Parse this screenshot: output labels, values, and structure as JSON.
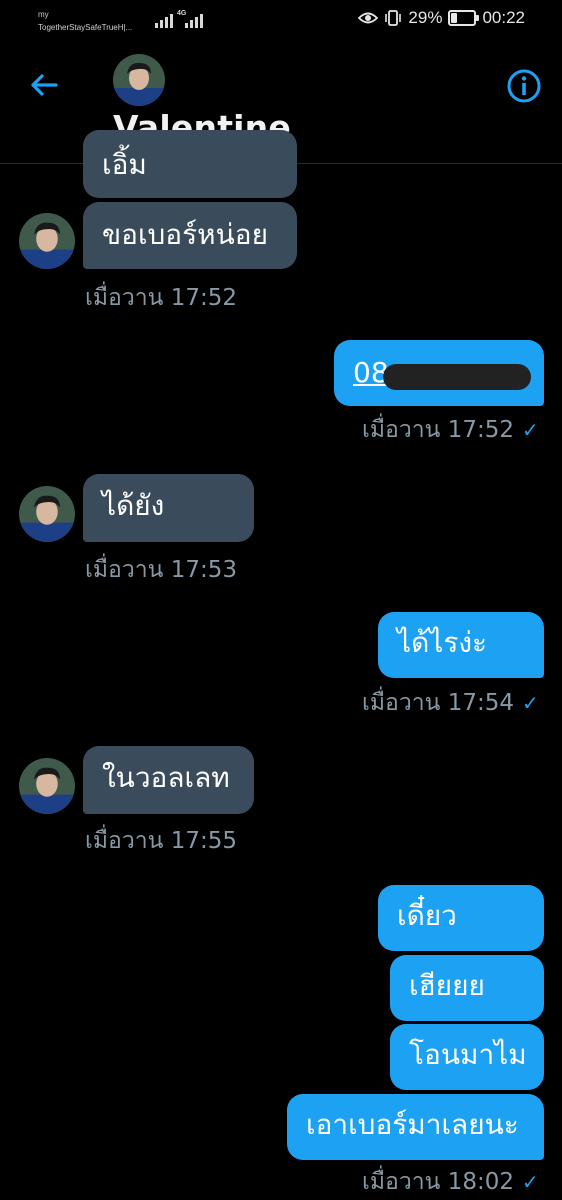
{
  "status_bar": {
    "carrier_line1": "my",
    "carrier_line2": "TogetherStaySafeTrueH|...",
    "network": "4G",
    "battery": "29%",
    "battery_level": 0.29,
    "time": "00:22"
  },
  "header": {
    "name": "Valentine",
    "back_icon": "arrow-left-icon",
    "info_icon": "info-icon"
  },
  "colors": {
    "background": "#000000",
    "incoming_bubble": "#3a4b5c",
    "outgoing_bubble": "#1da1f2",
    "timestamp": "#8899a6",
    "accent": "#1da1f2"
  },
  "messages": [
    {
      "id": "m0",
      "side": "in",
      "text": "เอิ้ม"
    },
    {
      "id": "m1",
      "side": "in",
      "text": "ขอเบอร์หน่อย",
      "time": "เมื่อวาน 17:52"
    },
    {
      "id": "m2",
      "side": "out",
      "text": "08",
      "time": "เมื่อวาน 17:52"
    },
    {
      "id": "m3",
      "side": "in",
      "text": "ได้ยัง",
      "time": "เมื่อวาน 17:53"
    },
    {
      "id": "m4",
      "side": "out",
      "text": "ได้ไรง่ะ",
      "time": "เมื่อวาน 17:54"
    },
    {
      "id": "m5",
      "side": "in",
      "text": "ในวอลเลท",
      "time": "เมื่อวาน 17:55"
    },
    {
      "id": "m6",
      "side": "out",
      "text": "เดี๋ยว"
    },
    {
      "id": "m7",
      "side": "out",
      "text": "เฮียยย"
    },
    {
      "id": "m8",
      "side": "out",
      "text": "โอนมาไม"
    },
    {
      "id": "m9",
      "side": "out",
      "text": "เอาเบอร์มาเลยนะ",
      "time": "เมื่อวาน 18:02"
    }
  ]
}
